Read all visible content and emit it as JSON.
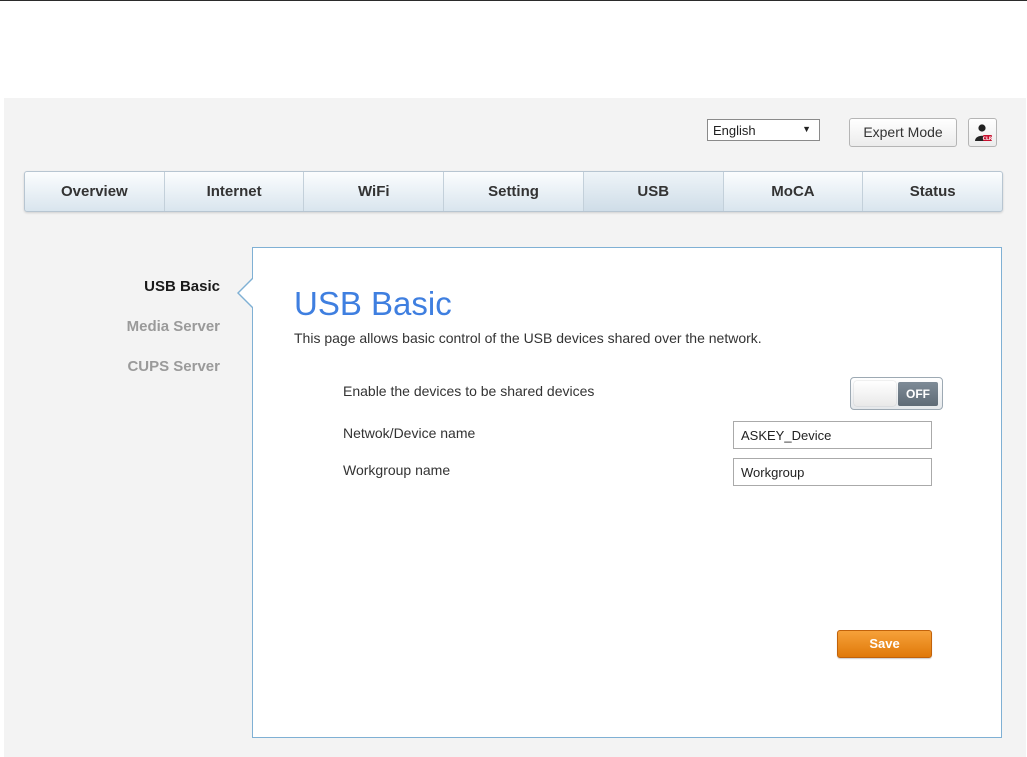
{
  "header": {
    "language": {
      "selected": "English"
    },
    "expert_mode_label": "Expert Mode",
    "user_icon": "user-admin-icon"
  },
  "nav": {
    "tabs": [
      {
        "label": "Overview",
        "active": false
      },
      {
        "label": "Internet",
        "active": false
      },
      {
        "label": "WiFi",
        "active": false
      },
      {
        "label": "Setting",
        "active": false
      },
      {
        "label": "USB",
        "active": true
      },
      {
        "label": "MoCA",
        "active": false
      },
      {
        "label": "Status",
        "active": false
      }
    ]
  },
  "sidebar": {
    "items": [
      {
        "label": "USB Basic",
        "active": true
      },
      {
        "label": "Media Server",
        "active": false
      },
      {
        "label": "CUPS Server",
        "active": false
      }
    ]
  },
  "main": {
    "title": "USB Basic",
    "description": "This page allows basic control of the USB devices shared over the network.",
    "share_label": "Enable the devices to be shared devices",
    "share_toggle": "OFF",
    "device_name_label": "Netwok/Device name",
    "device_name_value": "ASKEY_Device",
    "workgroup_label": "Workgroup name",
    "workgroup_value": "Workgroup",
    "save_label": "Save"
  },
  "colors": {
    "title": "#3f7fe0",
    "save": "#e98a1a",
    "panel_border": "#7fb0d4"
  }
}
